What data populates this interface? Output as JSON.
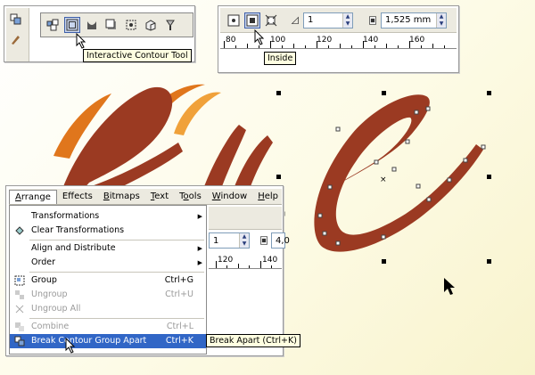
{
  "colors": {
    "artwork_primary": "#9b3a22",
    "artwork_swoosh": "#e0761c",
    "artwork_swoosh_light": "#f0a13a",
    "menu_highlight": "#3166c6",
    "tooltip_bg": "#ffffe1"
  },
  "toolbox": {
    "icons": [
      "pick-tool-icon",
      "interactive-contour-tool-icon",
      "blend-icon",
      "shadow-icon",
      "distort-icon",
      "extrude-icon",
      "transparency-icon"
    ],
    "active_icon": "interactive-contour-tool-icon",
    "tooltip": "Interactive Contour Tool"
  },
  "property_bar": {
    "buttons": [
      "to-center-icon",
      "inside-icon",
      "outside-icon"
    ],
    "active_button": "inside-icon",
    "steps_value": "1",
    "offset_value": "1,525 mm",
    "ruler_labels": [
      "80",
      "100",
      "120",
      "140",
      "160"
    ],
    "tooltip": "Inside"
  },
  "menu": {
    "bar": [
      "Arrange",
      "Effects",
      "Bitmaps",
      "Text",
      "Tools",
      "Window",
      "Help"
    ],
    "bar_underline": [
      "A",
      "f",
      "B",
      "T",
      "o",
      "W",
      "H"
    ],
    "open_menu": "Arrange",
    "items": [
      {
        "label": "Transformations",
        "shortcut": "",
        "submenu": true,
        "disabled": false
      },
      {
        "label": "Clear Transformations",
        "shortcut": "",
        "submenu": false,
        "disabled": false,
        "icon": "clear-transformations-icon"
      },
      {
        "label": "Align and Distribute",
        "shortcut": "",
        "submenu": true,
        "disabled": false
      },
      {
        "label": "Order",
        "shortcut": "",
        "submenu": true,
        "disabled": false
      },
      {
        "label": "Group",
        "shortcut": "Ctrl+G",
        "submenu": false,
        "disabled": false,
        "icon": "group-icon"
      },
      {
        "label": "Ungroup",
        "shortcut": "Ctrl+U",
        "submenu": false,
        "disabled": true,
        "icon": "ungroup-icon"
      },
      {
        "label": "Ungroup All",
        "shortcut": "",
        "submenu": false,
        "disabled": true,
        "icon": "ungroup-all-icon"
      },
      {
        "label": "Combine",
        "shortcut": "Ctrl+L",
        "submenu": false,
        "disabled": true,
        "icon": "combine-icon"
      },
      {
        "label": "Break Contour Group Apart",
        "shortcut": "Ctrl+K",
        "submenu": false,
        "disabled": false,
        "highlighted": true,
        "icon": "break-apart-icon"
      }
    ],
    "side_steps_value": "1",
    "side_offset_value": "4,0",
    "side_ruler_labels": [
      "120",
      "140"
    ],
    "tooltip": "Break Apart (Ctrl+K)"
  }
}
